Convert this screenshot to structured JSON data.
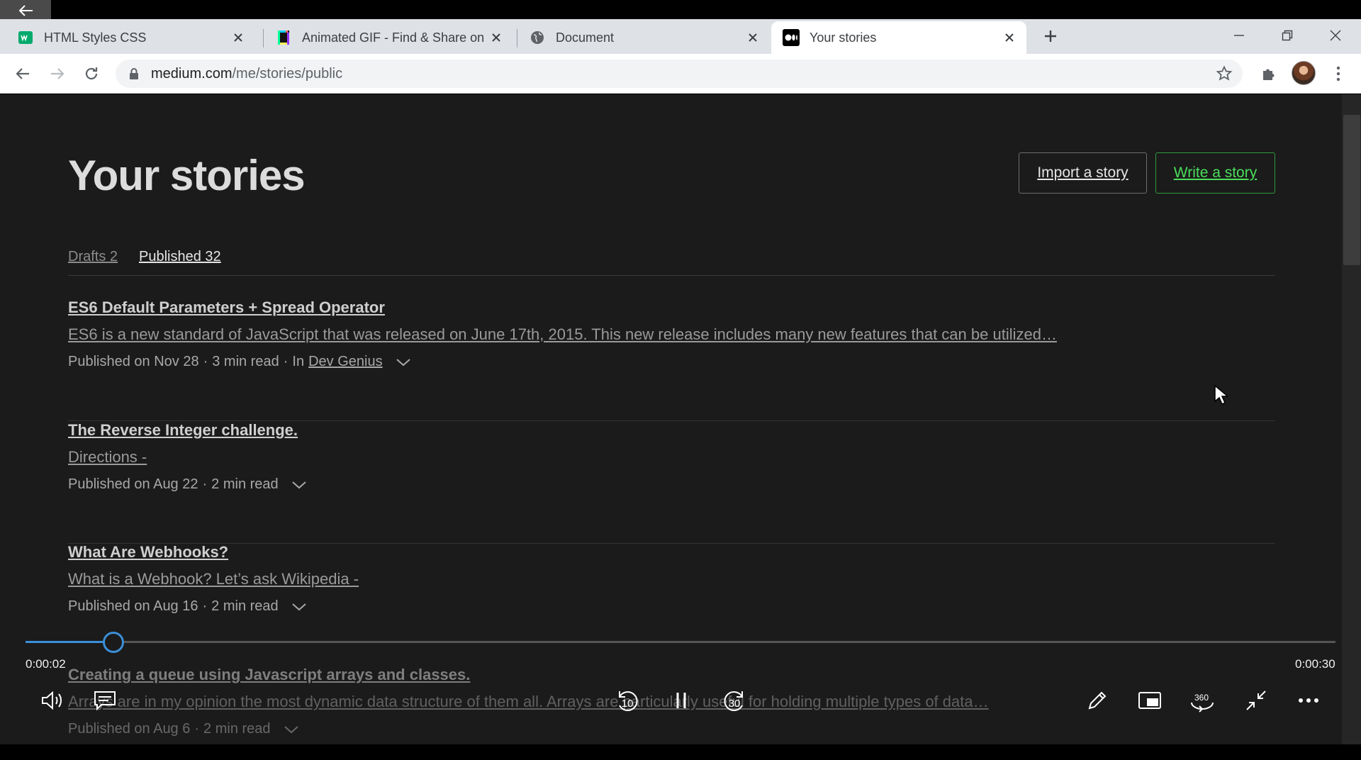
{
  "browser": {
    "tabs": [
      {
        "label": "HTML Styles CSS",
        "icon": "w3schools-icon"
      },
      {
        "label": "Animated GIF - Find & Share on GIPHY",
        "icon": "giphy-icon"
      },
      {
        "label": "Document",
        "icon": "globe-icon"
      },
      {
        "label": "Your stories",
        "icon": "medium-icon"
      }
    ],
    "url_host": "medium.com",
    "url_path": "/me/stories/public"
  },
  "page": {
    "title": "Your stories",
    "import_label": "Import a story",
    "write_label": "Write a story",
    "tab_drafts": "Drafts 2",
    "tab_published": "Published 32",
    "stories": [
      {
        "title": "ES6 Default Parameters + Spread Operator",
        "subtitle": "ES6 is a new standard of JavaScript that was released on June 17th, 2015. This new release includes many new features that can be utilized…",
        "published": "Published on Nov 28",
        "read": "3 min read",
        "in_prefix": "In",
        "publication": "Dev Genius"
      },
      {
        "title": "The Reverse Integer challenge.",
        "subtitle": "Directions -",
        "published": "Published on Aug 22",
        "read": "2 min read"
      },
      {
        "title": "What Are Webhooks?",
        "subtitle": "What is a Webhook? Let’s ask Wikipedia -",
        "published": "Published on Aug 16",
        "read": "2 min read"
      },
      {
        "title": "Creating a queue using Javascript arrays and classes.",
        "subtitle": "Arrays are in my opinion the most dynamic data structure of them all. Arrays are particularly useful for holding multiple types of data…",
        "published": "Published on Aug 6",
        "read": "2 min read"
      }
    ]
  },
  "player": {
    "current_time": "0:00:02",
    "total_time": "0:00:30",
    "progress_fraction": 0.067,
    "rewind_seconds": "10",
    "forward_seconds": "30",
    "vr_label": "360",
    "accent": "#3b8fd8"
  },
  "colors": {
    "page_bg": "#1b1b1b",
    "write_accent": "#4ade5a"
  }
}
